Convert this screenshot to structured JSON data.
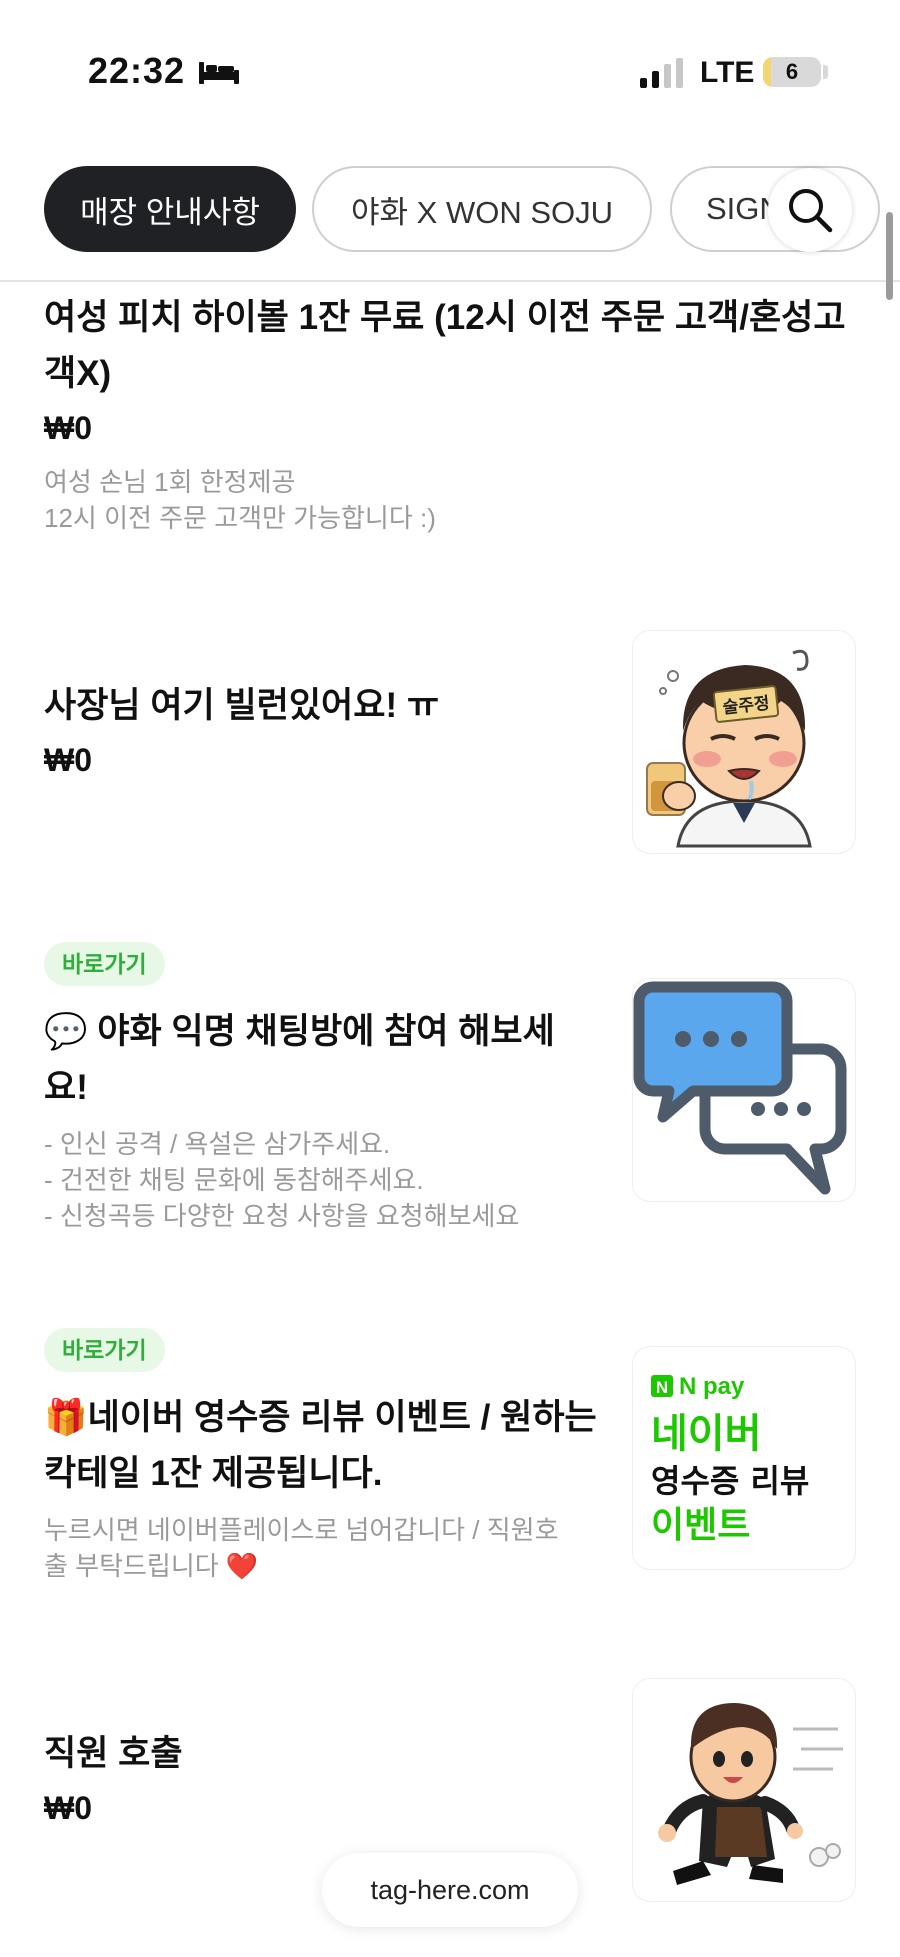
{
  "status_bar": {
    "time": "22:32",
    "network": "LTE",
    "battery": "6",
    "battery_level_percent": 6
  },
  "tabs": [
    {
      "label": "매장 안내사항",
      "active": true
    },
    {
      "label": "야화 X WON SOJU",
      "active": false
    },
    {
      "label": "SIGN",
      "active": false
    }
  ],
  "items": [
    {
      "title": "여성 피치 하이볼 1잔 무료 (12시 이전 주문 고객/혼성고객X)",
      "price": "₩0",
      "description": "여성 손님 1회 한정제공\n12시 이전 주문 고객만 가능합니다 :)"
    },
    {
      "title": "사장님 여기 빌런있어요! ㅠ",
      "price": "₩0",
      "image": {
        "name": "drunk-man-illustration",
        "label": "술주정"
      }
    },
    {
      "badge": "바로가기",
      "title": "💬 야화 익명 채팅방에 참여 해보세요!",
      "description": "- 인신 공격 / 욕설은 삼가주세요.\n- 건전한 채팅 문화에 동참해주세요.\n- 신청곡등 다양한 요청 사항을 요청해보세요",
      "image": {
        "name": "chat-bubbles-icon"
      }
    },
    {
      "badge": "바로가기",
      "title": "🎁네이버 영수증 리뷰 이벤트 / 원하는 칵테일 1잔 제공됩니다.",
      "description": "누르시면 네이버플레이스로 넘어갑니다  / 직원호출 부탁드립니다 ❤️",
      "image": {
        "name": "naver-pay-review-event",
        "brand": "N pay",
        "line1": "네이버",
        "line2": "영수증 리뷰",
        "line3": "이벤트"
      }
    },
    {
      "title": "직원 호출",
      "price": "₩0",
      "image": {
        "name": "running-waiter-illustration"
      }
    }
  ],
  "footer": {
    "domain": "tag-here.com"
  },
  "colors": {
    "active_tab": "#1f2125",
    "badge_bg": "#e8f8e6",
    "badge_text": "#2fae3a",
    "naver_green": "#1ec800"
  }
}
